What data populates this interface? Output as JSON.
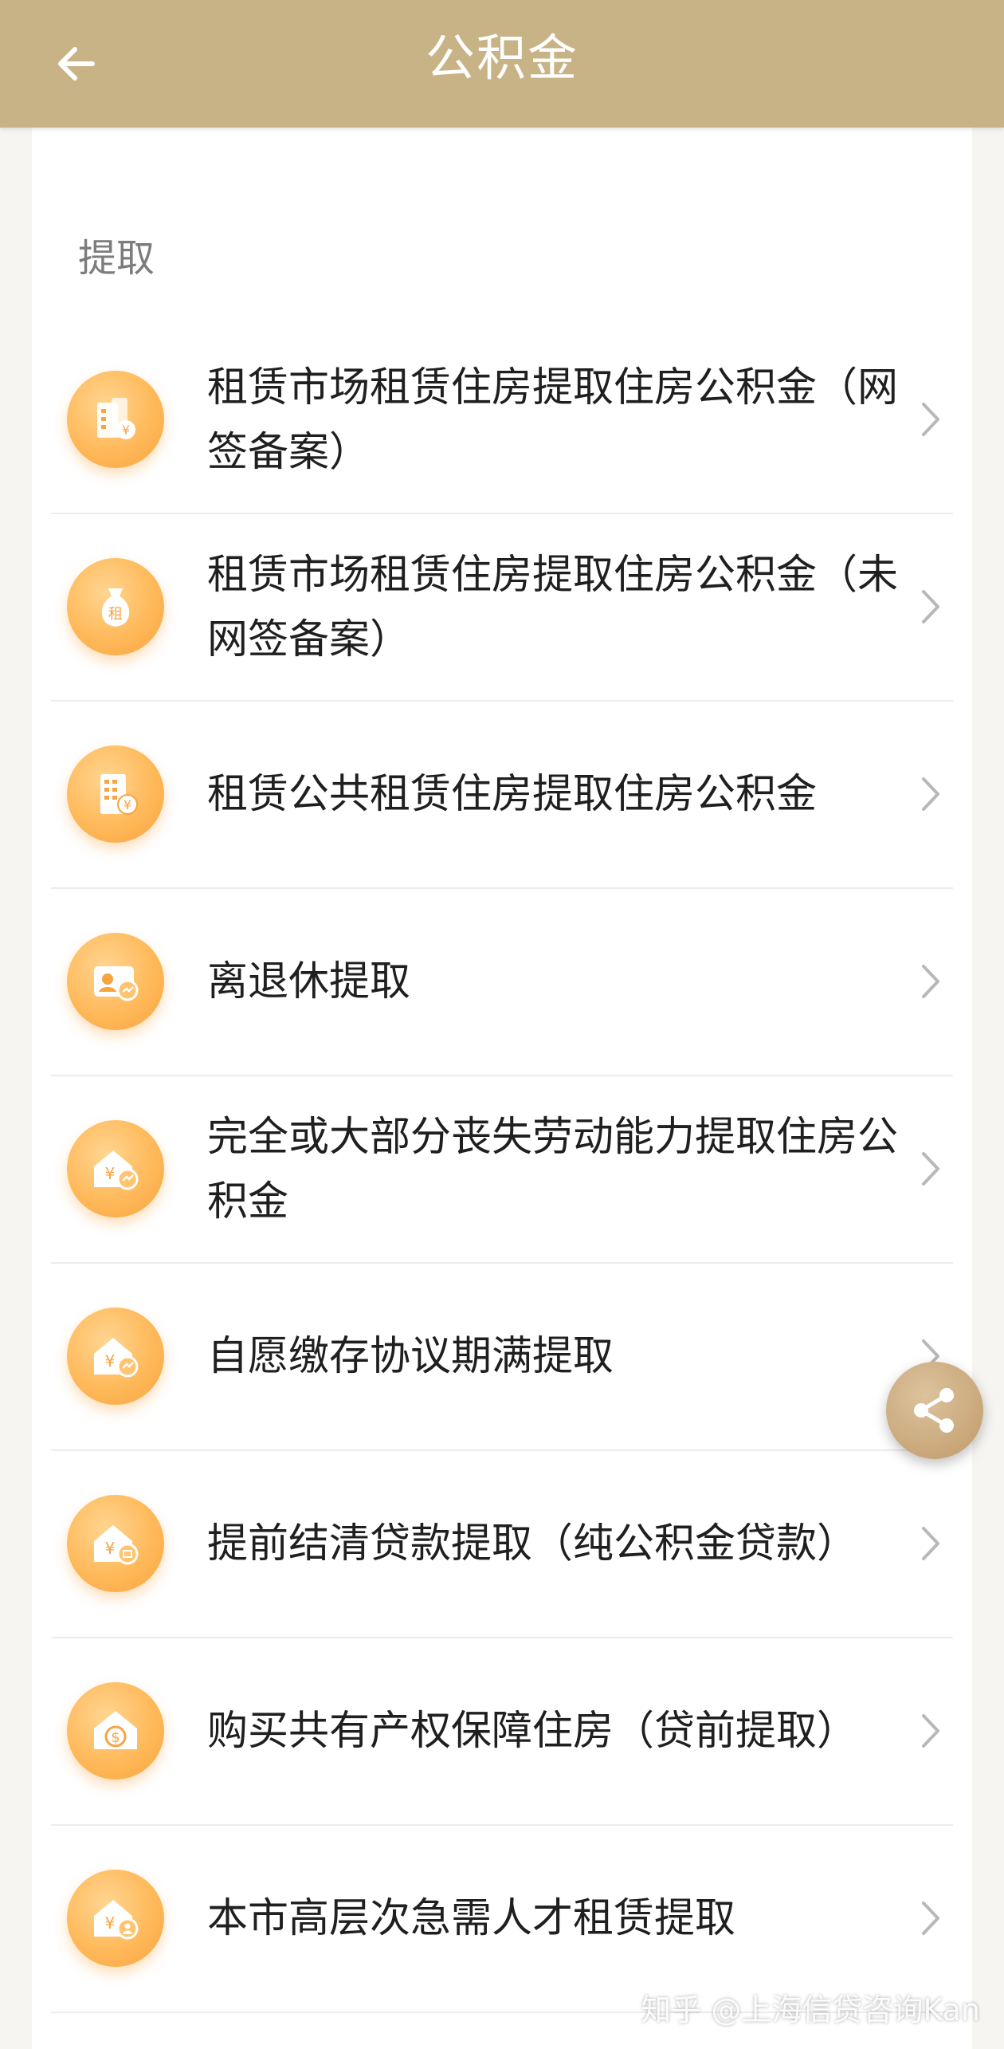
{
  "header": {
    "title": "公积金"
  },
  "section": {
    "label": "提取"
  },
  "items": [
    {
      "label": "租赁市场租赁住房提取住房公积金（网签备案）",
      "icon": "building-yuan-icon"
    },
    {
      "label": "租赁市场租赁住房提取住房公积金（未网签备案）",
      "icon": "money-bag-rent-icon"
    },
    {
      "label": "租赁公共租赁住房提取住房公积金",
      "icon": "office-building-yuan-icon"
    },
    {
      "label": "离退休提取",
      "icon": "retirement-card-icon"
    },
    {
      "label": "完全或大部分丧失劳动能力提取住房公积金",
      "icon": "house-yuan-icon"
    },
    {
      "label": "自愿缴存协议期满提取",
      "icon": "house-yuan-icon"
    },
    {
      "label": "提前结清贷款提取（纯公积金贷款）",
      "icon": "house-yuan-loan-icon"
    },
    {
      "label": "购买共有产权保障住房（贷前提取）",
      "icon": "house-dollar-icon"
    },
    {
      "label": "本市高层次急需人才租赁提取",
      "icon": "house-yuan-person-icon"
    }
  ],
  "icon_text": {
    "rent": "租"
  },
  "watermark": "知乎 @上海信贷咨询Kan",
  "colors": {
    "header": "#c8b387",
    "icon_orange": "#ffb95a",
    "share": "#c19a6a"
  }
}
